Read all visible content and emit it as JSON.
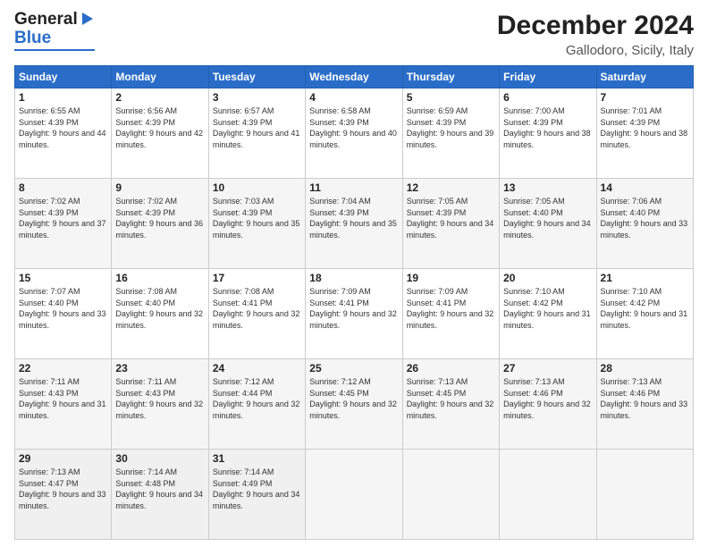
{
  "header": {
    "logo_general": "General",
    "logo_blue": "Blue",
    "title": "December 2024",
    "subtitle": "Gallodoro, Sicily, Italy"
  },
  "calendar": {
    "headers": [
      "Sunday",
      "Monday",
      "Tuesday",
      "Wednesday",
      "Thursday",
      "Friday",
      "Saturday"
    ],
    "weeks": [
      [
        {
          "day": "1",
          "sunrise": "Sunrise: 6:55 AM",
          "sunset": "Sunset: 4:39 PM",
          "daylight": "Daylight: 9 hours and 44 minutes."
        },
        {
          "day": "2",
          "sunrise": "Sunrise: 6:56 AM",
          "sunset": "Sunset: 4:39 PM",
          "daylight": "Daylight: 9 hours and 42 minutes."
        },
        {
          "day": "3",
          "sunrise": "Sunrise: 6:57 AM",
          "sunset": "Sunset: 4:39 PM",
          "daylight": "Daylight: 9 hours and 41 minutes."
        },
        {
          "day": "4",
          "sunrise": "Sunrise: 6:58 AM",
          "sunset": "Sunset: 4:39 PM",
          "daylight": "Daylight: 9 hours and 40 minutes."
        },
        {
          "day": "5",
          "sunrise": "Sunrise: 6:59 AM",
          "sunset": "Sunset: 4:39 PM",
          "daylight": "Daylight: 9 hours and 39 minutes."
        },
        {
          "day": "6",
          "sunrise": "Sunrise: 7:00 AM",
          "sunset": "Sunset: 4:39 PM",
          "daylight": "Daylight: 9 hours and 38 minutes."
        },
        {
          "day": "7",
          "sunrise": "Sunrise: 7:01 AM",
          "sunset": "Sunset: 4:39 PM",
          "daylight": "Daylight: 9 hours and 38 minutes."
        }
      ],
      [
        {
          "day": "8",
          "sunrise": "Sunrise: 7:02 AM",
          "sunset": "Sunset: 4:39 PM",
          "daylight": "Daylight: 9 hours and 37 minutes."
        },
        {
          "day": "9",
          "sunrise": "Sunrise: 7:02 AM",
          "sunset": "Sunset: 4:39 PM",
          "daylight": "Daylight: 9 hours and 36 minutes."
        },
        {
          "day": "10",
          "sunrise": "Sunrise: 7:03 AM",
          "sunset": "Sunset: 4:39 PM",
          "daylight": "Daylight: 9 hours and 35 minutes."
        },
        {
          "day": "11",
          "sunrise": "Sunrise: 7:04 AM",
          "sunset": "Sunset: 4:39 PM",
          "daylight": "Daylight: 9 hours and 35 minutes."
        },
        {
          "day": "12",
          "sunrise": "Sunrise: 7:05 AM",
          "sunset": "Sunset: 4:39 PM",
          "daylight": "Daylight: 9 hours and 34 minutes."
        },
        {
          "day": "13",
          "sunrise": "Sunrise: 7:05 AM",
          "sunset": "Sunset: 4:40 PM",
          "daylight": "Daylight: 9 hours and 34 minutes."
        },
        {
          "day": "14",
          "sunrise": "Sunrise: 7:06 AM",
          "sunset": "Sunset: 4:40 PM",
          "daylight": "Daylight: 9 hours and 33 minutes."
        }
      ],
      [
        {
          "day": "15",
          "sunrise": "Sunrise: 7:07 AM",
          "sunset": "Sunset: 4:40 PM",
          "daylight": "Daylight: 9 hours and 33 minutes."
        },
        {
          "day": "16",
          "sunrise": "Sunrise: 7:08 AM",
          "sunset": "Sunset: 4:40 PM",
          "daylight": "Daylight: 9 hours and 32 minutes."
        },
        {
          "day": "17",
          "sunrise": "Sunrise: 7:08 AM",
          "sunset": "Sunset: 4:41 PM",
          "daylight": "Daylight: 9 hours and 32 minutes."
        },
        {
          "day": "18",
          "sunrise": "Sunrise: 7:09 AM",
          "sunset": "Sunset: 4:41 PM",
          "daylight": "Daylight: 9 hours and 32 minutes."
        },
        {
          "day": "19",
          "sunrise": "Sunrise: 7:09 AM",
          "sunset": "Sunset: 4:41 PM",
          "daylight": "Daylight: 9 hours and 32 minutes."
        },
        {
          "day": "20",
          "sunrise": "Sunrise: 7:10 AM",
          "sunset": "Sunset: 4:42 PM",
          "daylight": "Daylight: 9 hours and 31 minutes."
        },
        {
          "day": "21",
          "sunrise": "Sunrise: 7:10 AM",
          "sunset": "Sunset: 4:42 PM",
          "daylight": "Daylight: 9 hours and 31 minutes."
        }
      ],
      [
        {
          "day": "22",
          "sunrise": "Sunrise: 7:11 AM",
          "sunset": "Sunset: 4:43 PM",
          "daylight": "Daylight: 9 hours and 31 minutes."
        },
        {
          "day": "23",
          "sunrise": "Sunrise: 7:11 AM",
          "sunset": "Sunset: 4:43 PM",
          "daylight": "Daylight: 9 hours and 32 minutes."
        },
        {
          "day": "24",
          "sunrise": "Sunrise: 7:12 AM",
          "sunset": "Sunset: 4:44 PM",
          "daylight": "Daylight: 9 hours and 32 minutes."
        },
        {
          "day": "25",
          "sunrise": "Sunrise: 7:12 AM",
          "sunset": "Sunset: 4:45 PM",
          "daylight": "Daylight: 9 hours and 32 minutes."
        },
        {
          "day": "26",
          "sunrise": "Sunrise: 7:13 AM",
          "sunset": "Sunset: 4:45 PM",
          "daylight": "Daylight: 9 hours and 32 minutes."
        },
        {
          "day": "27",
          "sunrise": "Sunrise: 7:13 AM",
          "sunset": "Sunset: 4:46 PM",
          "daylight": "Daylight: 9 hours and 32 minutes."
        },
        {
          "day": "28",
          "sunrise": "Sunrise: 7:13 AM",
          "sunset": "Sunset: 4:46 PM",
          "daylight": "Daylight: 9 hours and 33 minutes."
        }
      ],
      [
        {
          "day": "29",
          "sunrise": "Sunrise: 7:13 AM",
          "sunset": "Sunset: 4:47 PM",
          "daylight": "Daylight: 9 hours and 33 minutes."
        },
        {
          "day": "30",
          "sunrise": "Sunrise: 7:14 AM",
          "sunset": "Sunset: 4:48 PM",
          "daylight": "Daylight: 9 hours and 34 minutes."
        },
        {
          "day": "31",
          "sunrise": "Sunrise: 7:14 AM",
          "sunset": "Sunset: 4:49 PM",
          "daylight": "Daylight: 9 hours and 34 minutes."
        },
        null,
        null,
        null,
        null
      ]
    ]
  }
}
